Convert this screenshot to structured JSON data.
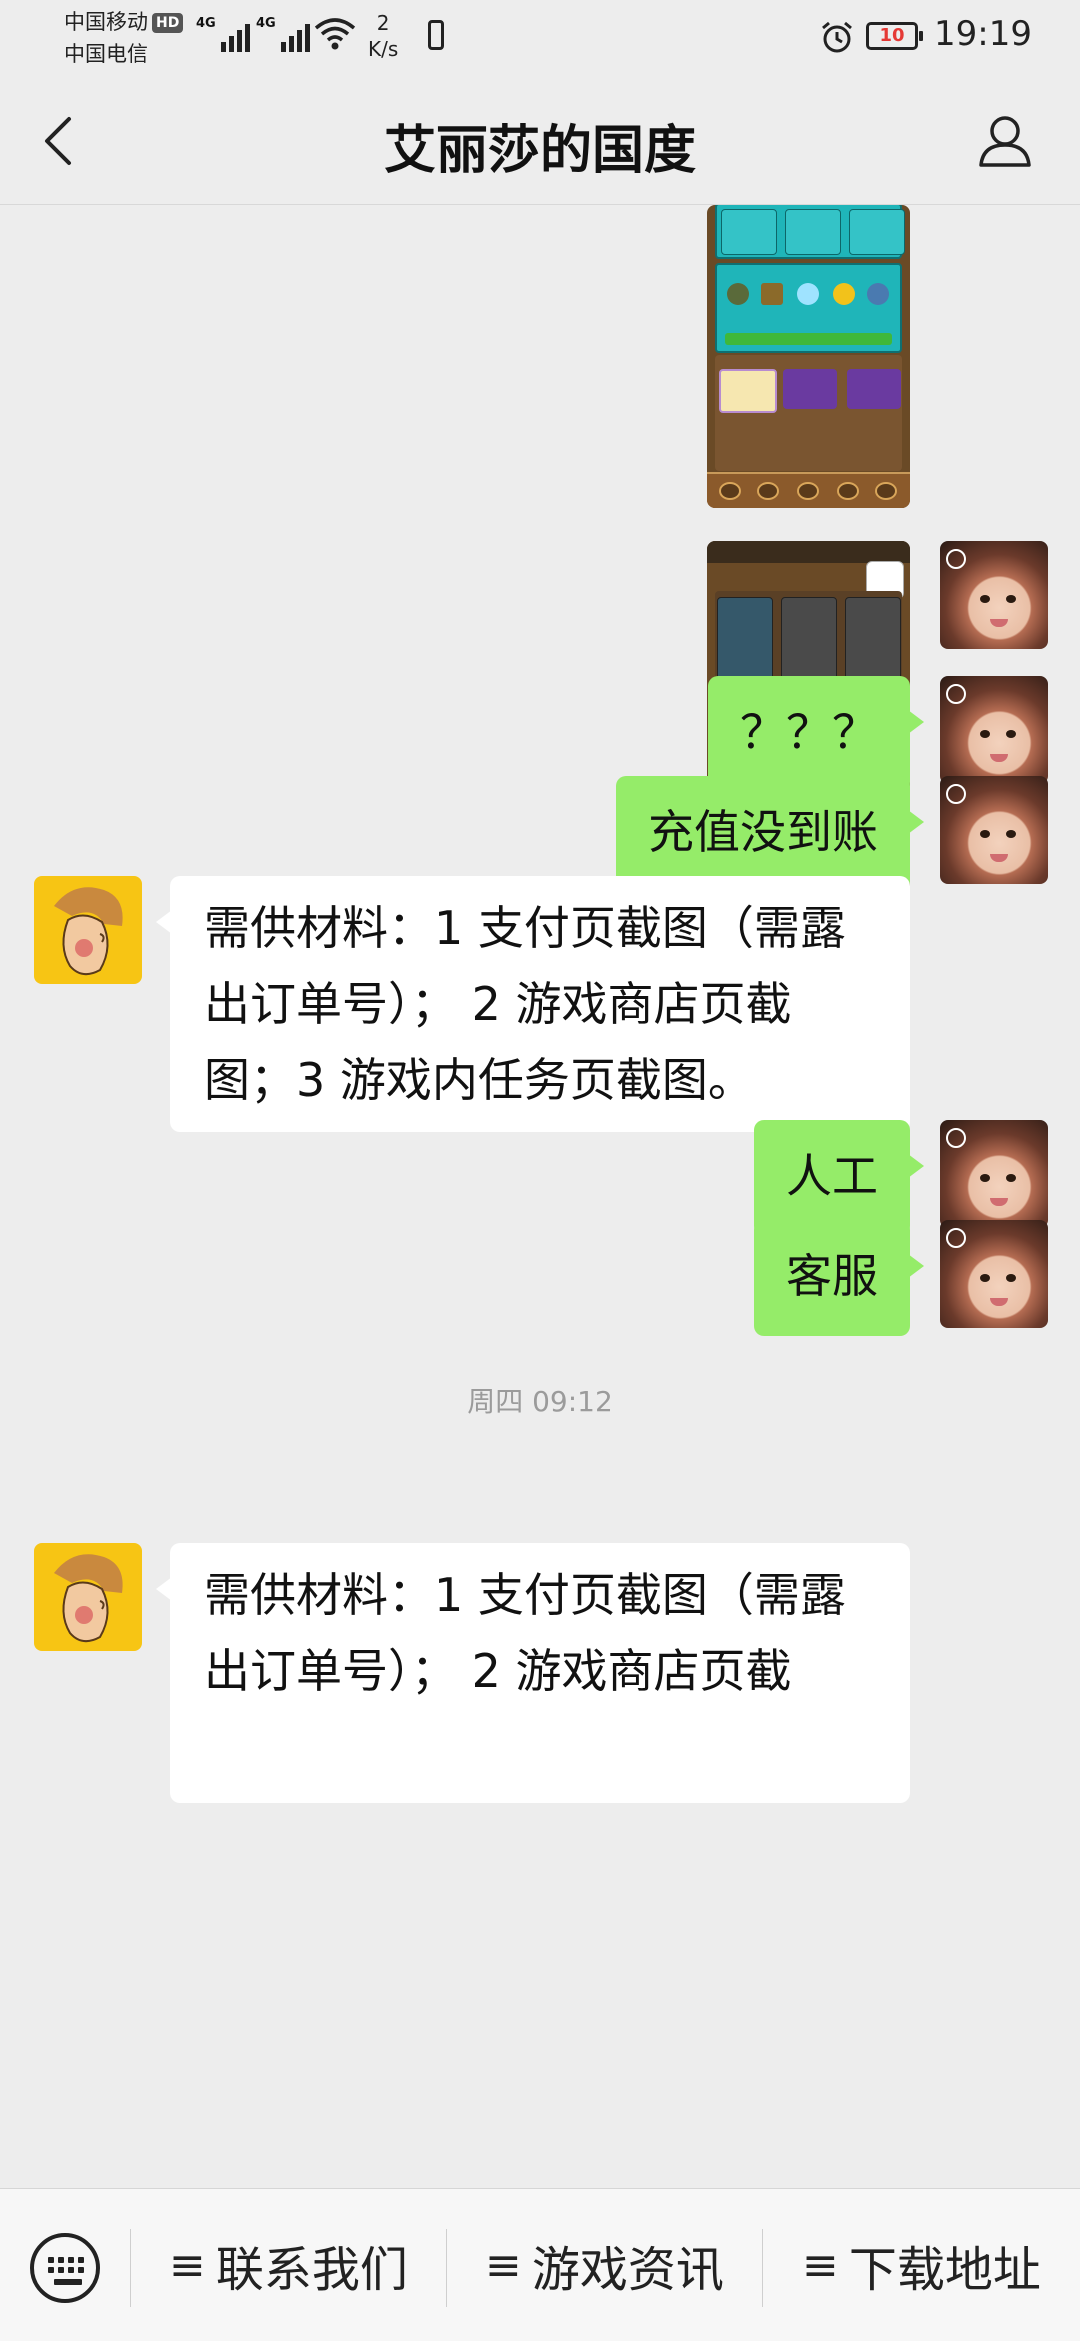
{
  "status_bar": {
    "carrier_1": "中国移动",
    "hd_badge": "HD",
    "carrier_2": "中国电信",
    "signal_1_label": "4G",
    "signal_2_label": "4G",
    "speed_value": "2",
    "speed_unit": "K/s",
    "battery": "10",
    "time": "19:19"
  },
  "header": {
    "title": "艾丽莎的国度"
  },
  "messages": [
    {
      "sender": "me",
      "type": "image"
    },
    {
      "sender": "me",
      "type": "image"
    },
    {
      "sender": "me",
      "type": "text",
      "text": "？？？"
    },
    {
      "sender": "me",
      "type": "text",
      "text": "充值没到账"
    },
    {
      "sender": "them",
      "type": "text",
      "lines": [
        "需供材料：1 支付页截图（需露",
        "出订单号）； 2 游戏商店页截",
        "图；3 游戏内任务页截图。"
      ]
    },
    {
      "sender": "me",
      "type": "text",
      "text": "人工"
    },
    {
      "sender": "me",
      "type": "text",
      "text": "客服"
    },
    {
      "type": "timestamp",
      "text": "周四 09:12"
    },
    {
      "sender": "them",
      "type": "text",
      "lines": [
        "需供材料：1 支付页截图（需露",
        "出订单号）； 2 游戏商店页截"
      ]
    }
  ],
  "bottom_menu": {
    "items": [
      {
        "label": "联系我们"
      },
      {
        "label": "游戏资讯"
      },
      {
        "label": "下载地址"
      }
    ],
    "menu_glyph": "≡"
  },
  "colors": {
    "background": "#ededed",
    "my_bubble": "#95ec69",
    "their_bubble": "#ffffff",
    "timestamp_text": "#9b9b9b",
    "battery_low": "#e53935"
  },
  "icons": [
    "back-arrow-icon",
    "profile-icon",
    "keyboard-icon",
    "alarm-icon",
    "wifi-icon",
    "signal-icon",
    "battery-icon"
  ]
}
